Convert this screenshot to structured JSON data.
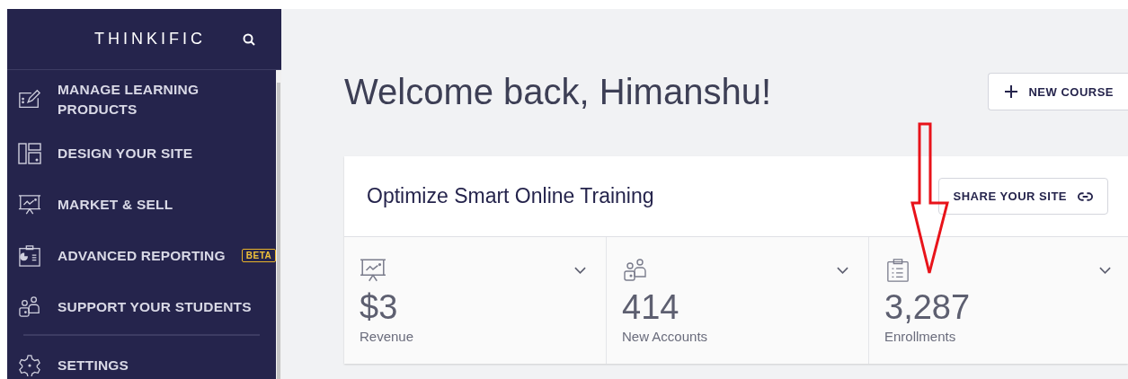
{
  "sidebar": {
    "logo": "THINKIFIC",
    "items": [
      {
        "kind": "edit",
        "label": "MANAGE LEARNING PRODUCTS"
      },
      {
        "kind": "layout",
        "label": "DESIGN YOUR SITE"
      },
      {
        "kind": "chart",
        "label": "MARKET & SELL"
      },
      {
        "kind": "report",
        "label": "ADVANCED REPORTING",
        "badge": "BETA"
      },
      {
        "kind": "people",
        "label": "SUPPORT YOUR STUDENTS"
      },
      {
        "kind": "gear",
        "label": "SETTINGS",
        "divider_before": true
      }
    ]
  },
  "main": {
    "heading": "Welcome back, Himanshu!",
    "new_course_button": "NEW COURSE",
    "card": {
      "title": "Optimize Smart Online Training",
      "share_button": "SHARE YOUR SITE",
      "stats": [
        {
          "kind": "chart",
          "value": "$3",
          "label": "Revenue"
        },
        {
          "kind": "people",
          "value": "414",
          "label": "New Accounts"
        },
        {
          "kind": "clipboard",
          "value": "3,287",
          "label": "Enrollments"
        }
      ]
    }
  }
}
